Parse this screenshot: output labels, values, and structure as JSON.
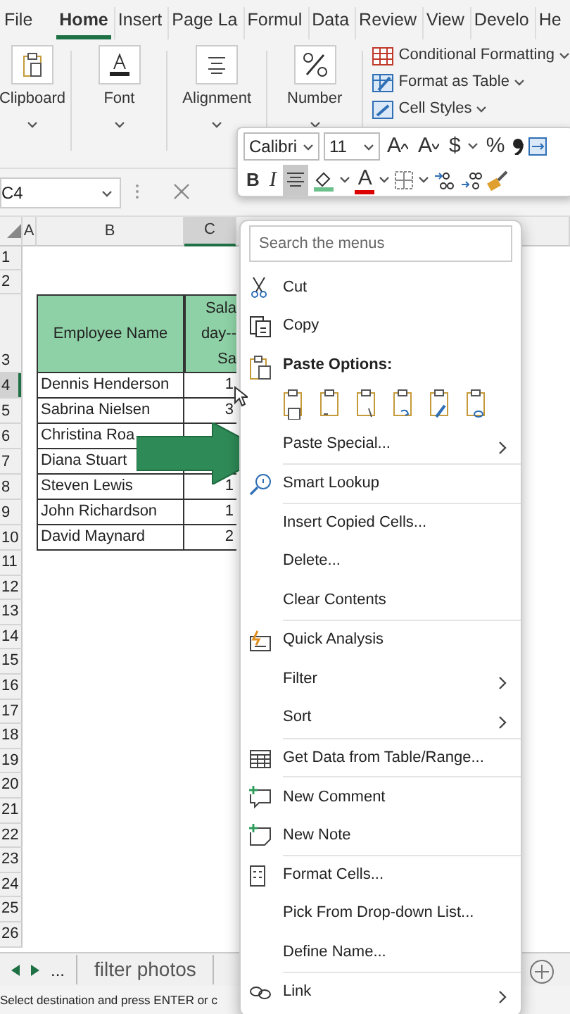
{
  "ribbon_tabs": [
    {
      "label": "File",
      "selected": false
    },
    {
      "label": "Home",
      "selected": true
    },
    {
      "label": "Insert",
      "selected": false
    },
    {
      "label": "Page La",
      "selected": false
    },
    {
      "label": "Formul",
      "selected": false
    },
    {
      "label": "Data",
      "selected": false
    },
    {
      "label": "Review",
      "selected": false
    },
    {
      "label": "View",
      "selected": false
    },
    {
      "label": "Develo",
      "selected": false
    },
    {
      "label": "He",
      "selected": false
    }
  ],
  "ribbon_groups": [
    {
      "label": "Clipboard"
    },
    {
      "label": "Font"
    },
    {
      "label": "Alignment"
    },
    {
      "label": "Number"
    }
  ],
  "styles_commands": [
    "Conditional Formatting",
    "Format as Table",
    "Cell Styles"
  ],
  "name_box": "C4",
  "mini_toolbar": {
    "font_name": "Calibri",
    "font_size": "11",
    "grow_label": "A",
    "shrink_label": "A",
    "currency_label": "$",
    "percent_label": "%",
    "bold_label": "B",
    "italic_label": "I",
    "font_color_label": "A",
    "center_selected": true
  },
  "columns": [
    {
      "label": "A",
      "selected": false
    },
    {
      "label": "B",
      "selected": false
    },
    {
      "label": "C",
      "selected": true
    }
  ],
  "rows": [
    {
      "number": "1",
      "selected": false,
      "kind": "empty"
    },
    {
      "number": "2",
      "selected": false,
      "kind": "empty"
    },
    {
      "number": "3",
      "selected": false,
      "kind": "header",
      "name": "Employee Name",
      "value": "Sala\nday--\nSa"
    },
    {
      "number": "4",
      "selected": true,
      "kind": "data",
      "name": "Dennis Henderson",
      "value": "1"
    },
    {
      "number": "5",
      "selected": false,
      "kind": "data",
      "name": "Sabrina Nielsen",
      "value": "3"
    },
    {
      "number": "6",
      "selected": false,
      "kind": "data",
      "name": "Christina Roa"
    },
    {
      "number": "7",
      "selected": false,
      "kind": "data",
      "name": "Diana Stuart"
    },
    {
      "number": "8",
      "selected": false,
      "kind": "data",
      "name": "Steven Lewis",
      "value": "1"
    },
    {
      "number": "9",
      "selected": false,
      "kind": "data",
      "name": "John Richardson",
      "value": "1"
    },
    {
      "number": "10",
      "selected": false,
      "kind": "data",
      "name": "David Maynard",
      "value": "2"
    },
    {
      "number": "11",
      "selected": false,
      "kind": "empty"
    },
    {
      "number": "12",
      "selected": false,
      "kind": "empty"
    },
    {
      "number": "13",
      "selected": false,
      "kind": "empty"
    },
    {
      "number": "14",
      "selected": false,
      "kind": "empty"
    },
    {
      "number": "15",
      "selected": false,
      "kind": "empty"
    },
    {
      "number": "16",
      "selected": false,
      "kind": "empty"
    },
    {
      "number": "17",
      "selected": false,
      "kind": "empty"
    },
    {
      "number": "18",
      "selected": false,
      "kind": "empty"
    },
    {
      "number": "19",
      "selected": false,
      "kind": "empty"
    },
    {
      "number": "20",
      "selected": false,
      "kind": "empty"
    },
    {
      "number": "21",
      "selected": false,
      "kind": "empty"
    },
    {
      "number": "22",
      "selected": false,
      "kind": "empty"
    },
    {
      "number": "23",
      "selected": false,
      "kind": "empty"
    },
    {
      "number": "24",
      "selected": false,
      "kind": "empty"
    },
    {
      "number": "25",
      "selected": false,
      "kind": "empty"
    },
    {
      "number": "26",
      "selected": false,
      "kind": "empty"
    }
  ],
  "sheet_tabs": {
    "more": "...",
    "tabs": [
      {
        "label": "filter photos",
        "selected": false
      }
    ]
  },
  "status_bar": "Select destination and press ENTER or c",
  "context_menu": {
    "search_placeholder": "Search the menus",
    "items": [
      {
        "kind": "command",
        "label": "Cut",
        "submenu": false,
        "divider_above": false
      },
      {
        "kind": "command",
        "label": "Copy",
        "submenu": false,
        "divider_above": false
      },
      {
        "kind": "heading",
        "label": "Paste Options:",
        "submenu": false,
        "divider_above": false
      },
      {
        "kind": "paste-icons",
        "divider_above": false
      },
      {
        "kind": "command",
        "label": "Paste Special...",
        "submenu": true,
        "divider_above": false
      },
      {
        "kind": "command",
        "label": "Smart Lookup",
        "submenu": false,
        "divider_above": true
      },
      {
        "kind": "command",
        "label": "Insert Copied Cells...",
        "submenu": false,
        "divider_above": true
      },
      {
        "kind": "command",
        "label": "Delete...",
        "submenu": false,
        "divider_above": false
      },
      {
        "kind": "command",
        "label": "Clear Contents",
        "submenu": false,
        "divider_above": false
      },
      {
        "kind": "command",
        "label": "Quick Analysis",
        "submenu": false,
        "divider_above": true
      },
      {
        "kind": "command",
        "label": "Filter",
        "submenu": true,
        "divider_above": false
      },
      {
        "kind": "command",
        "label": "Sort",
        "submenu": true,
        "divider_above": false
      },
      {
        "kind": "command",
        "label": "Get Data from Table/Range...",
        "submenu": false,
        "divider_above": true
      },
      {
        "kind": "command",
        "label": "New Comment",
        "submenu": false,
        "divider_above": true
      },
      {
        "kind": "command",
        "label": "New Note",
        "submenu": false,
        "divider_above": false
      },
      {
        "kind": "command",
        "label": "Format Cells...",
        "submenu": false,
        "divider_above": true
      },
      {
        "kind": "command",
        "label": "Pick From Drop-down List...",
        "submenu": false,
        "divider_above": false
      },
      {
        "kind": "command",
        "label": "Define Name...",
        "submenu": false,
        "divider_above": false
      },
      {
        "kind": "command",
        "label": "Link",
        "submenu": true,
        "divider_above": true
      }
    ]
  }
}
